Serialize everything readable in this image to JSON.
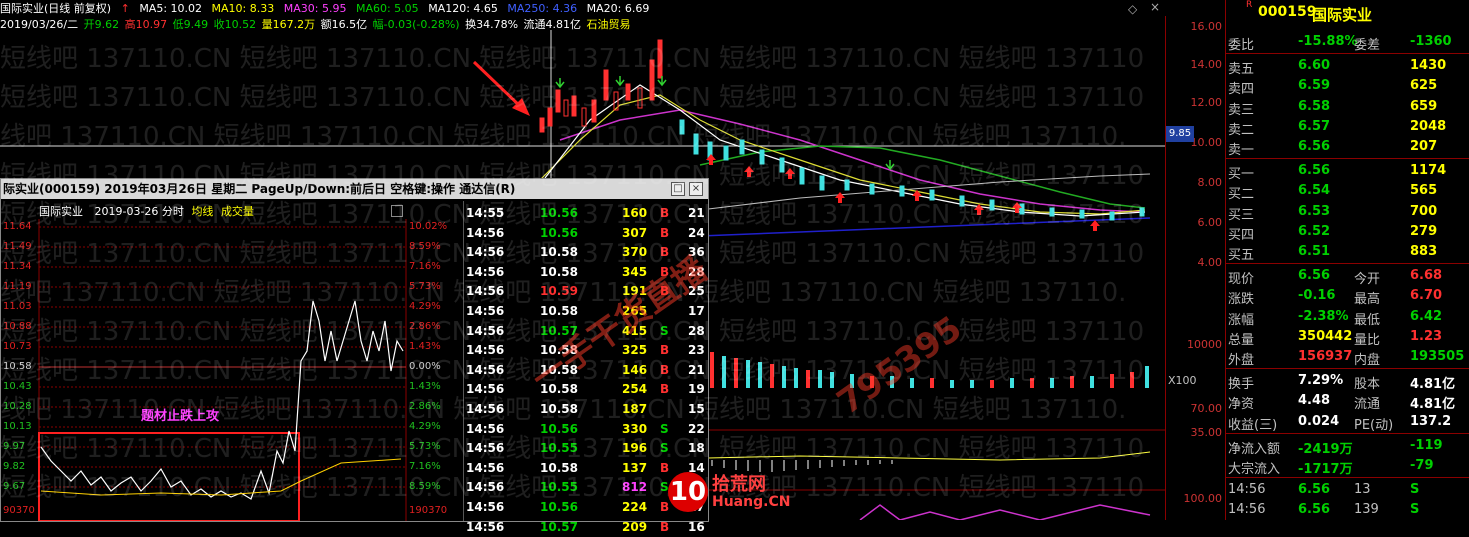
{
  "topbar": {
    "title": "国际实业(日线 前复权)",
    "ma5": "MA5: 10.02",
    "ma10": "MA10: 8.33",
    "ma30": "MA30: 5.95",
    "ma60": "MA60: 5.05",
    "ma120": "MA120: 4.65",
    "ma250": "MA250: 4.36",
    "ma20": "MA20: 6.69"
  },
  "infobar": {
    "date": "2019/03/26/二",
    "open": "开9.62",
    "high": "高10.97",
    "low": "低9.49",
    "close": "收10.52",
    "volume": "量167.2万",
    "amount": "额16.5亿",
    "change": "幅-0.03(-0.28%)",
    "turnover": "换34.78%",
    "float": "流通4.81亿",
    "sector": "石油贸易"
  },
  "watermark_lines": [
    "短线吧 137110.CN 短线吧 137110.CN 短线吧 137110.CN 短线吧 137110.CN 短线吧 137110",
    "短线吧 137110.CN 短线吧 137110.CN 短线吧 137110.CN 短线吧 137110.CN 短线吧 137110",
    "线吧 137110.CN 短线吧 137110.CN 短线吧 137110.CN 短线吧 137110.CN 短线吧 137110.",
    "短线吧 137110.CN 短线吧 137110.CN 短线吧 137110.CN 短线吧 137110.CN 短线吧 137110",
    "短线吧 137110.CN 短线吧 137110.CN 短线吧 137110.CN 短线吧 137110.CN 短线吧 137110",
    "短线吧 137110.CN 短线吧 137110.CN 短线吧 137110.CN 短线吧 137110.CN 短线吧 137110",
    "线吧 137110.CN 短线吧 137110.CN 短线吧 137110.CN 短线吧 137110.CN 短线吧 137110.",
    "短线吧 137110.CN 短线吧 137110.CN 短线吧 137110.CN 短线吧 137110.CN 短线吧 137110",
    "短线吧 137110.CN 短线吧 137110.CN 短线吧 137110.CN 短线吧 137110.CN 短线吧 137110",
    "线吧 137110.CN 短线吧 137110.CN 短线吧 137110.CN 短线吧 137110.CN 短线吧 137110.",
    "短线吧 137110.CN 短线吧 137110.CN 短线吧 137110.CN 短线吧 137110.CN 短线吧 137110",
    "短线吧 137110.CN 短线吧 137110.CN 短线吧 137110.CN 短线吧 137110.CN 短线吧 137110"
  ],
  "price_axis": [
    "16.00",
    "14.00",
    "12.00",
    "10.00",
    "8.00",
    "6.00",
    "4.00"
  ],
  "volume_axis": [
    "10000",
    "X100",
    "70.00",
    "35.00",
    "100.00"
  ],
  "current_price_tag": "9.85",
  "popup": {
    "title": "际实业(000159) 2019年03月26日 星期二 PageUp/Down:前后日 空格键:操作 通达信(R)",
    "min_btn": "□",
    "close_btn": "×",
    "mini_head": {
      "name": "国际实业",
      "date": "2019-03-26 分时",
      "avg": "均线",
      "vol": "成交量"
    },
    "left_scale": [
      "11.64",
      "11.49",
      "11.34",
      "11.19",
      "11.03",
      "10.88",
      "10.73",
      "10.58",
      "10.43",
      "10.28",
      "10.13",
      "9.97",
      "9.82",
      "9.67",
      "90370"
    ],
    "right_scale": [
      "10.02%",
      "8.59%",
      "7.16%",
      "5.73%",
      "4.29%",
      "2.86%",
      "1.43%",
      "0.00%",
      "1.43%",
      "2.86%",
      "4.29%",
      "5.73%",
      "7.16%",
      "8.59%",
      "190370"
    ],
    "overlay_text": "题材止跌上攻",
    "ticks": [
      {
        "time": "14:55",
        "price": "10.56",
        "vol": "160",
        "bs": "B",
        "n": "21"
      },
      {
        "time": "14:56",
        "price": "10.56",
        "vol": "307",
        "bs": "B",
        "n": "24"
      },
      {
        "time": "14:56",
        "price": "10.58",
        "vol": "370",
        "bs": "B",
        "n": "36"
      },
      {
        "time": "14:56",
        "price": "10.58",
        "vol": "345",
        "bs": "B",
        "n": "28"
      },
      {
        "time": "14:56",
        "price": "10.59",
        "vol": "191",
        "bs": "B",
        "n": "25"
      },
      {
        "time": "14:56",
        "price": "10.58",
        "vol": "265",
        "bs": "",
        "n": "17"
      },
      {
        "time": "14:56",
        "price": "10.57",
        "vol": "415",
        "bs": "S",
        "n": "28"
      },
      {
        "time": "14:56",
        "price": "10.58",
        "vol": "325",
        "bs": "B",
        "n": "23"
      },
      {
        "time": "14:56",
        "price": "10.58",
        "vol": "146",
        "bs": "B",
        "n": "21"
      },
      {
        "time": "14:56",
        "price": "10.58",
        "vol": "254",
        "bs": "B",
        "n": "19"
      },
      {
        "time": "14:56",
        "price": "10.58",
        "vol": "187",
        "bs": "",
        "n": "15"
      },
      {
        "time": "14:56",
        "price": "10.56",
        "vol": "330",
        "bs": "S",
        "n": "22"
      },
      {
        "time": "14:56",
        "price": "10.55",
        "vol": "196",
        "bs": "S",
        "n": "18"
      },
      {
        "time": "14:56",
        "price": "10.58",
        "vol": "137",
        "bs": "B",
        "n": "14"
      },
      {
        "time": "14:56",
        "price": "10.55",
        "vol": "812",
        "bs": "S",
        "n": "36"
      },
      {
        "time": "14:56",
        "price": "10.56",
        "vol": "224",
        "bs": "B",
        "n": "17"
      },
      {
        "time": "14:56",
        "price": "10.57",
        "vol": "209",
        "bs": "B",
        "n": "16"
      }
    ]
  },
  "stamp": {
    "line1": "一手干货直播",
    "line2": "795395"
  },
  "logo": {
    "num": "10",
    "cn": "拾荒网",
    "url": "Huang.CN"
  },
  "quote": {
    "code": "000159",
    "name": "国际实业",
    "rows": [
      {
        "l1": "委比",
        "v1": "-15.88%",
        "l2": "委差",
        "v2": "-1360",
        "c1": "grn",
        "c2": "grn"
      },
      {
        "l1": "卖五",
        "v1": "6.60",
        "l2": "",
        "v2": "1430",
        "c1": "grn",
        "c2": "yel"
      },
      {
        "l1": "卖四",
        "v1": "6.59",
        "l2": "",
        "v2": "625",
        "c1": "grn",
        "c2": "yel"
      },
      {
        "l1": "卖三",
        "v1": "6.58",
        "l2": "",
        "v2": "659",
        "c1": "grn",
        "c2": "yel"
      },
      {
        "l1": "卖二",
        "v1": "6.57",
        "l2": "",
        "v2": "2048",
        "c1": "grn",
        "c2": "yel"
      },
      {
        "l1": "卖一",
        "v1": "6.56",
        "l2": "",
        "v2": "207",
        "c1": "grn",
        "c2": "yel"
      },
      {
        "l1": "买一",
        "v1": "6.56",
        "l2": "",
        "v2": "1174",
        "c1": "grn",
        "c2": "yel"
      },
      {
        "l1": "买二",
        "v1": "6.54",
        "l2": "",
        "v2": "565",
        "c1": "grn",
        "c2": "yel"
      },
      {
        "l1": "买三",
        "v1": "6.53",
        "l2": "",
        "v2": "700",
        "c1": "grn",
        "c2": "yel"
      },
      {
        "l1": "买四",
        "v1": "6.52",
        "l2": "",
        "v2": "279",
        "c1": "grn",
        "c2": "yel"
      },
      {
        "l1": "买五",
        "v1": "6.51",
        "l2": "",
        "v2": "883",
        "c1": "grn",
        "c2": "yel"
      },
      {
        "l1": "现价",
        "v1": "6.56",
        "l2": "今开",
        "v2": "6.68",
        "c1": "grn",
        "c2": "red"
      },
      {
        "l1": "涨跌",
        "v1": "-0.16",
        "l2": "最高",
        "v2": "6.70",
        "c1": "grn",
        "c2": "red"
      },
      {
        "l1": "涨幅",
        "v1": "-2.38%",
        "l2": "最低",
        "v2": "6.42",
        "c1": "grn",
        "c2": "grn"
      },
      {
        "l1": "总量",
        "v1": "350442",
        "l2": "量比",
        "v2": "1.23",
        "c1": "yel",
        "c2": "red"
      },
      {
        "l1": "外盘",
        "v1": "156937",
        "l2": "内盘",
        "v2": "193505",
        "c1": "red",
        "c2": "grn"
      },
      {
        "l1": "换手",
        "v1": "7.29%",
        "l2": "股本",
        "v2": "4.81亿",
        "c1": "wht",
        "c2": "wht"
      },
      {
        "l1": "净资",
        "v1": "4.48",
        "l2": "流通",
        "v2": "4.81亿",
        "c1": "wht",
        "c2": "wht"
      },
      {
        "l1": "收益(三)",
        "v1": "0.024",
        "l2": "PE(动)",
        "v2": "137.2",
        "c1": "wht",
        "c2": "wht"
      },
      {
        "l1": "净流入额",
        "v1": "-2419万",
        "l2": "",
        "v2": "-119",
        "c1": "grn",
        "c2": "grn"
      },
      {
        "l1": "大宗流入",
        "v1": "-1717万",
        "l2": "",
        "v2": "-79",
        "c1": "grn",
        "c2": "grn"
      },
      {
        "l1": "14:56",
        "v1": "6.56",
        "l2": "13",
        "v2": "S",
        "c1": "grn",
        "c2": "grn"
      },
      {
        "l1": "14:56",
        "v1": "6.56",
        "l2": "139",
        "v2": "S",
        "c1": "grn",
        "c2": "grn"
      }
    ]
  }
}
